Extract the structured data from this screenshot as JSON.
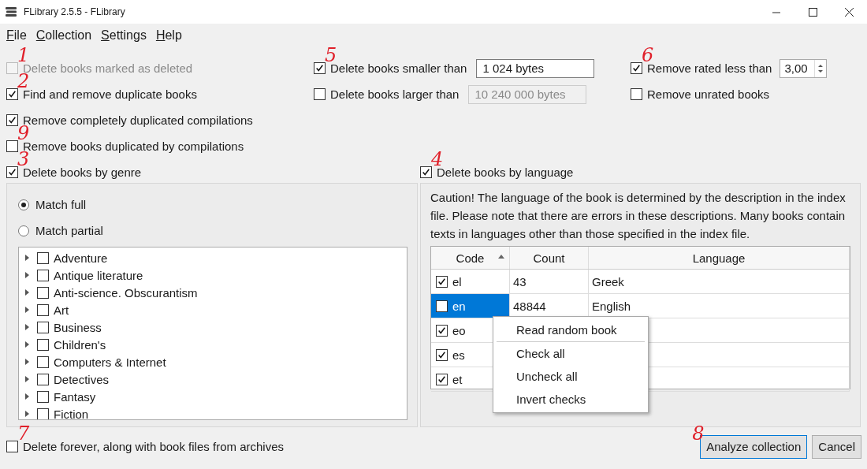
{
  "window": {
    "title": "FLibrary 2.5.5 - FLibrary"
  },
  "menu": [
    {
      "label": "File"
    },
    {
      "label": "Collection"
    },
    {
      "label": "Settings"
    },
    {
      "label": "Help"
    }
  ],
  "options": [
    {
      "label": "Delete books marked as deleted",
      "checked": false,
      "disabled": true,
      "note": "1"
    },
    {
      "label": "Find and remove duplicate books",
      "checked": true,
      "disabled": false,
      "note": "2"
    },
    {
      "label": "Remove completely duplicated compilations",
      "checked": true,
      "disabled": false
    },
    {
      "label": "Remove books duplicated by compilations",
      "checked": false,
      "disabled": false,
      "note": "9"
    }
  ],
  "size_filters": [
    {
      "label": "Delete books smaller than",
      "checked": true,
      "value": "1 024 bytes",
      "disabled": false,
      "note": "5"
    },
    {
      "label": "Delete books larger than",
      "checked": false,
      "value": "10 240 000 bytes",
      "disabled": true
    }
  ],
  "rating_filters": [
    {
      "kind": "spin",
      "label": "Remove rated less than",
      "checked": true,
      "value": "3,00",
      "note": "6"
    },
    {
      "kind": "plain",
      "label": "Remove unrated books",
      "checked": false
    }
  ],
  "genre": {
    "label": "Delete books by genre",
    "checked": true,
    "note": "3",
    "match": [
      {
        "label": "Match full",
        "selected": true
      },
      {
        "label": "Match partial",
        "selected": false
      }
    ],
    "tree": [
      {
        "label": "Adventure",
        "checked": false
      },
      {
        "label": "Antique literature",
        "checked": false
      },
      {
        "label": "Anti-science. Obscurantism",
        "checked": false
      },
      {
        "label": "Art",
        "checked": false
      },
      {
        "label": "Business",
        "checked": false
      },
      {
        "label": "Children's",
        "checked": false
      },
      {
        "label": "Computers & Internet",
        "checked": false
      },
      {
        "label": "Detectives",
        "checked": false
      },
      {
        "label": "Fantasy",
        "checked": false
      },
      {
        "label": "Fiction",
        "checked": false
      }
    ]
  },
  "language": {
    "label": "Delete books by language",
    "checked": true,
    "note": "4",
    "caution": "Caution! The language of the book is determined by the description in the index file. Please note that there are errors in these descriptions. Many books contain texts in languages other than those specified in the index file.",
    "columns": [
      {
        "label": "Code",
        "sorted": true
      },
      {
        "label": "Count",
        "sorted": false
      },
      {
        "label": "Language",
        "sorted": false
      }
    ],
    "rows": [
      {
        "checked": true,
        "selected": false,
        "code": "el",
        "count": "43",
        "language": "Greek"
      },
      {
        "checked": false,
        "selected": true,
        "code": "en",
        "count": "48844",
        "language": "English"
      },
      {
        "checked": true,
        "selected": false,
        "code": "eo"
      },
      {
        "checked": true,
        "selected": false,
        "code": "es"
      },
      {
        "checked": true,
        "selected": false,
        "code": "et"
      }
    ],
    "context_menu": [
      {
        "label": "Read random book",
        "separator_after": true
      },
      {
        "label": "Check all",
        "separator_after": false
      },
      {
        "label": "Uncheck all",
        "separator_after": false
      },
      {
        "label": "Invert checks",
        "separator_after": false
      }
    ]
  },
  "footer": {
    "label": "Delete forever, along with book files from archives",
    "checked": false,
    "note": "7",
    "buttons": [
      {
        "label": "Analyze collection",
        "default": true,
        "note": "8"
      },
      {
        "label": "Cancel",
        "default": false
      }
    ]
  }
}
